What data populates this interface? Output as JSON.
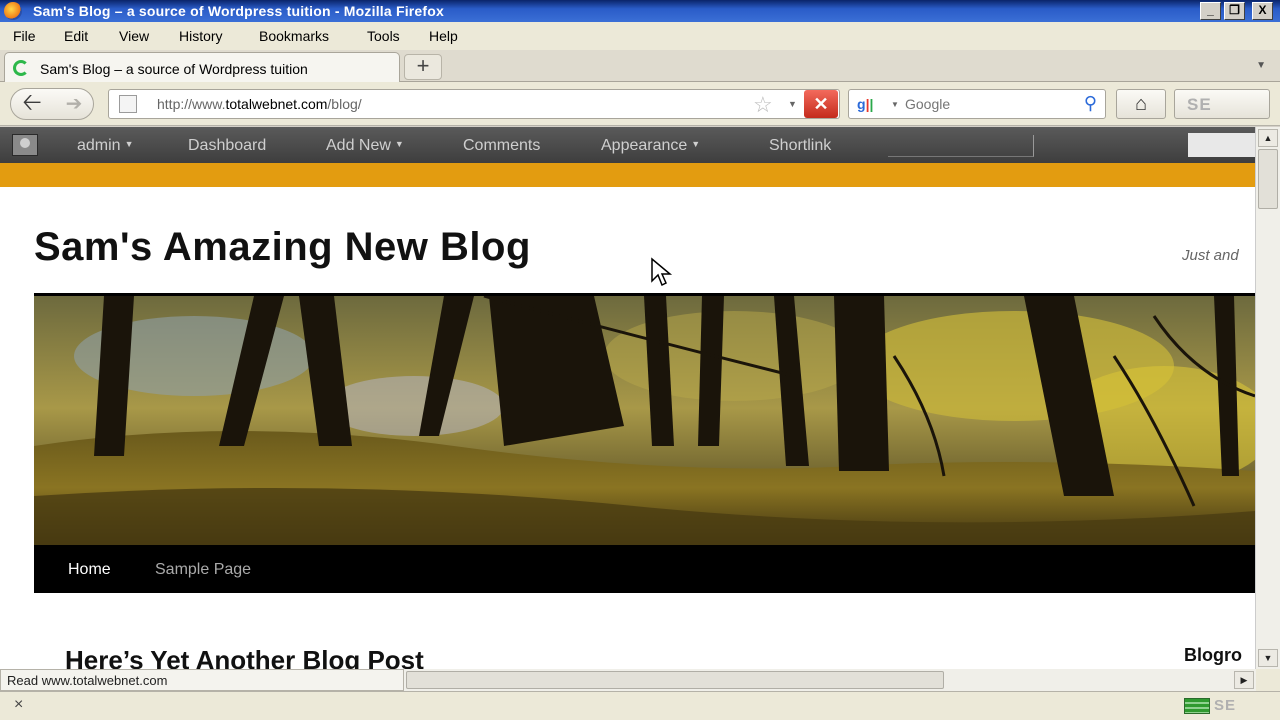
{
  "window": {
    "title": "Sam's Blog – a source of Wordpress tuition - Mozilla Firefox",
    "controls": [
      "_",
      "❐",
      "X"
    ]
  },
  "menubar": {
    "items": [
      "File",
      "Edit",
      "View",
      "History",
      "Bookmarks",
      "Tools",
      "Help"
    ]
  },
  "tabs": {
    "active_label": "Sam's Blog – a source of Wordpress tuition",
    "new_tab": "+"
  },
  "navbar": {
    "url_prefix": "http://www.",
    "url_domain": "totalwebnet.com",
    "url_path": "/blog/",
    "search_engine": "google-icon",
    "search_placeholder": "Google",
    "seo_button": "SE"
  },
  "adminbar": {
    "items": [
      "admin",
      "Dashboard",
      "Add New",
      "Comments",
      "Appearance",
      "Shortlink"
    ]
  },
  "blog": {
    "site_title": "Sam's Amazing New Blog",
    "site_description": "Just and",
    "nav": [
      "Home",
      "Sample Page"
    ],
    "post_title": "Here’s Yet Another Blog Post",
    "sidebar_widget_title": "Blogro"
  },
  "status": {
    "text": "Read www.totalwebnet.com"
  },
  "addonbar": {
    "close": "×",
    "seo_label": "SE"
  },
  "colors": {
    "accent_orange": "#e39c10",
    "admin_bar": "#464646",
    "blog_nav": "#000000"
  }
}
